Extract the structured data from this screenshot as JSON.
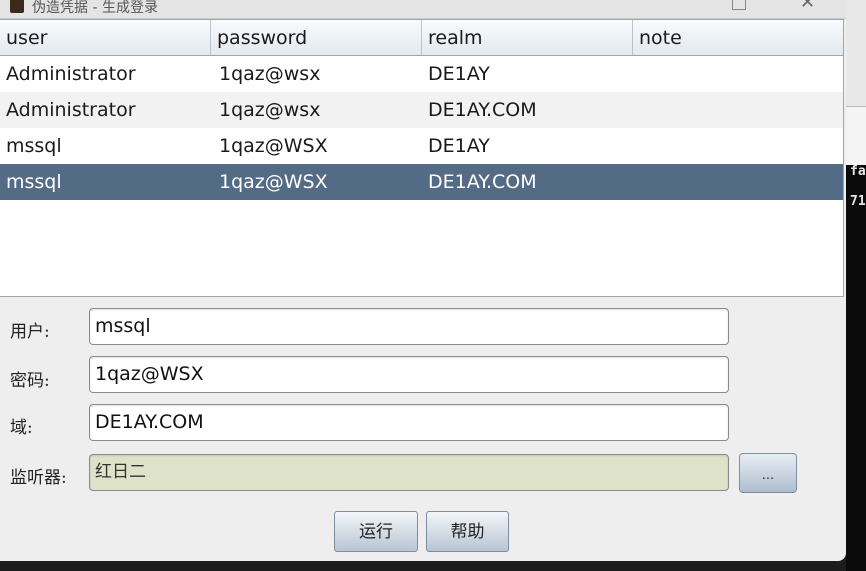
{
  "window": {
    "title": "伪造凭据 - 生成登录"
  },
  "table": {
    "columns": [
      "user",
      "password",
      "realm",
      "note"
    ],
    "rows": [
      {
        "user": "Administrator",
        "password": "1qaz@wsx",
        "realm": "DE1AY",
        "note": ""
      },
      {
        "user": "Administrator",
        "password": "1qaz@wsx",
        "realm": "DE1AY.COM",
        "note": ""
      },
      {
        "user": "mssql",
        "password": "1qaz@WSX",
        "realm": "DE1AY",
        "note": ""
      },
      {
        "user": "mssql",
        "password": "1qaz@WSX",
        "realm": "DE1AY.COM",
        "note": ""
      }
    ],
    "selected_row": 3
  },
  "form": {
    "user_label": "用户:",
    "user_value": "mssql",
    "password_label": "密码:",
    "password_value": "1qaz@WSX",
    "domain_label": "域:",
    "domain_value": "DE1AY.COM",
    "listener_label": "监听器:",
    "listener_value": "红日二",
    "browse_label": "..."
  },
  "buttons": {
    "run_label": "运行",
    "help_label": "帮助"
  },
  "background": {
    "terminal_line1": "fa",
    "terminal_line2": "71"
  },
  "colors": {
    "selected_row": "#536b85",
    "listener_field": "#dde2c9"
  }
}
